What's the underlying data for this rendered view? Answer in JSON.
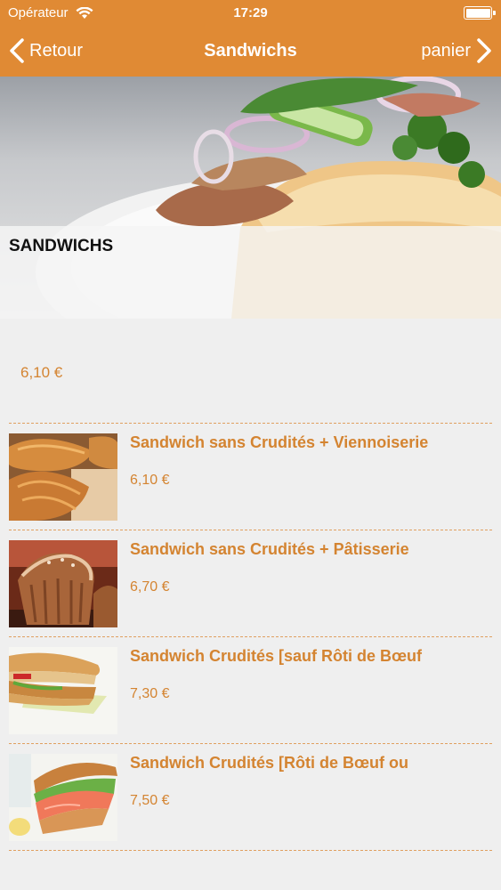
{
  "status_bar": {
    "carrier": "Opérateur",
    "time": "17:29"
  },
  "nav": {
    "back_label": "Retour",
    "title": "Sandwichs",
    "cart_label": "panier"
  },
  "hero": {
    "title": "SANDWICHS"
  },
  "first_item": {
    "price": "6,10 €"
  },
  "items": [
    {
      "name": "Sandwich sans Crudités + Viennoiserie",
      "price": "6,10 €",
      "thumb": "croissants"
    },
    {
      "name": "Sandwich sans Crudités + Pâtisserie",
      "price": "6,70 €",
      "thumb": "muffins"
    },
    {
      "name": "Sandwich Crudités [sauf Rôti de Bœuf",
      "price": "7,30 €",
      "thumb": "baguette-chicken"
    },
    {
      "name": "Sandwich Crudités [Rôti de Bœuf ou",
      "price": "7,50 €",
      "thumb": "baguette-salmon"
    }
  ],
  "colors": {
    "accent": "#e08a34",
    "price_text": "#d48431",
    "background": "#efefef"
  }
}
